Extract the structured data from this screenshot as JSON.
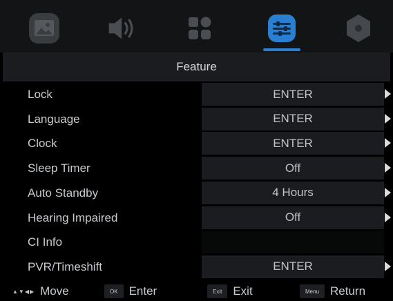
{
  "tabs": [
    {
      "icon": "picture-icon"
    },
    {
      "icon": "sound-icon"
    },
    {
      "icon": "apps-icon"
    },
    {
      "icon": "feature-settings-icon",
      "active": true
    },
    {
      "icon": "setup-disc-icon"
    }
  ],
  "colors": {
    "accent": "#2a7fd0",
    "row_bg": "#1a1c1f",
    "background": "#000000"
  },
  "title": "Feature",
  "menu_rows": [
    {
      "label": "Lock",
      "value": "ENTER",
      "has_arrow": true
    },
    {
      "label": "Language",
      "value": "ENTER",
      "has_arrow": true
    },
    {
      "label": "Clock",
      "value": "ENTER",
      "has_arrow": true
    },
    {
      "label": "Sleep Timer",
      "value": "Off",
      "has_arrow": true
    },
    {
      "label": "Auto Standby",
      "value": "4 Hours",
      "has_arrow": true
    },
    {
      "label": "Hearing Impaired",
      "value": "Off",
      "has_arrow": true
    },
    {
      "label": "CI Info",
      "value": "",
      "has_arrow": false
    },
    {
      "label": "PVR/Timeshift",
      "value": "ENTER",
      "has_arrow": true
    }
  ],
  "footer": {
    "move": {
      "arrows": "▲▼◀▶",
      "label": "Move"
    },
    "enter": {
      "key": "OK",
      "label": "Enter"
    },
    "exit": {
      "key": "Exit",
      "label": "Exit"
    },
    "return": {
      "key": "Menu",
      "label": "Return"
    }
  }
}
